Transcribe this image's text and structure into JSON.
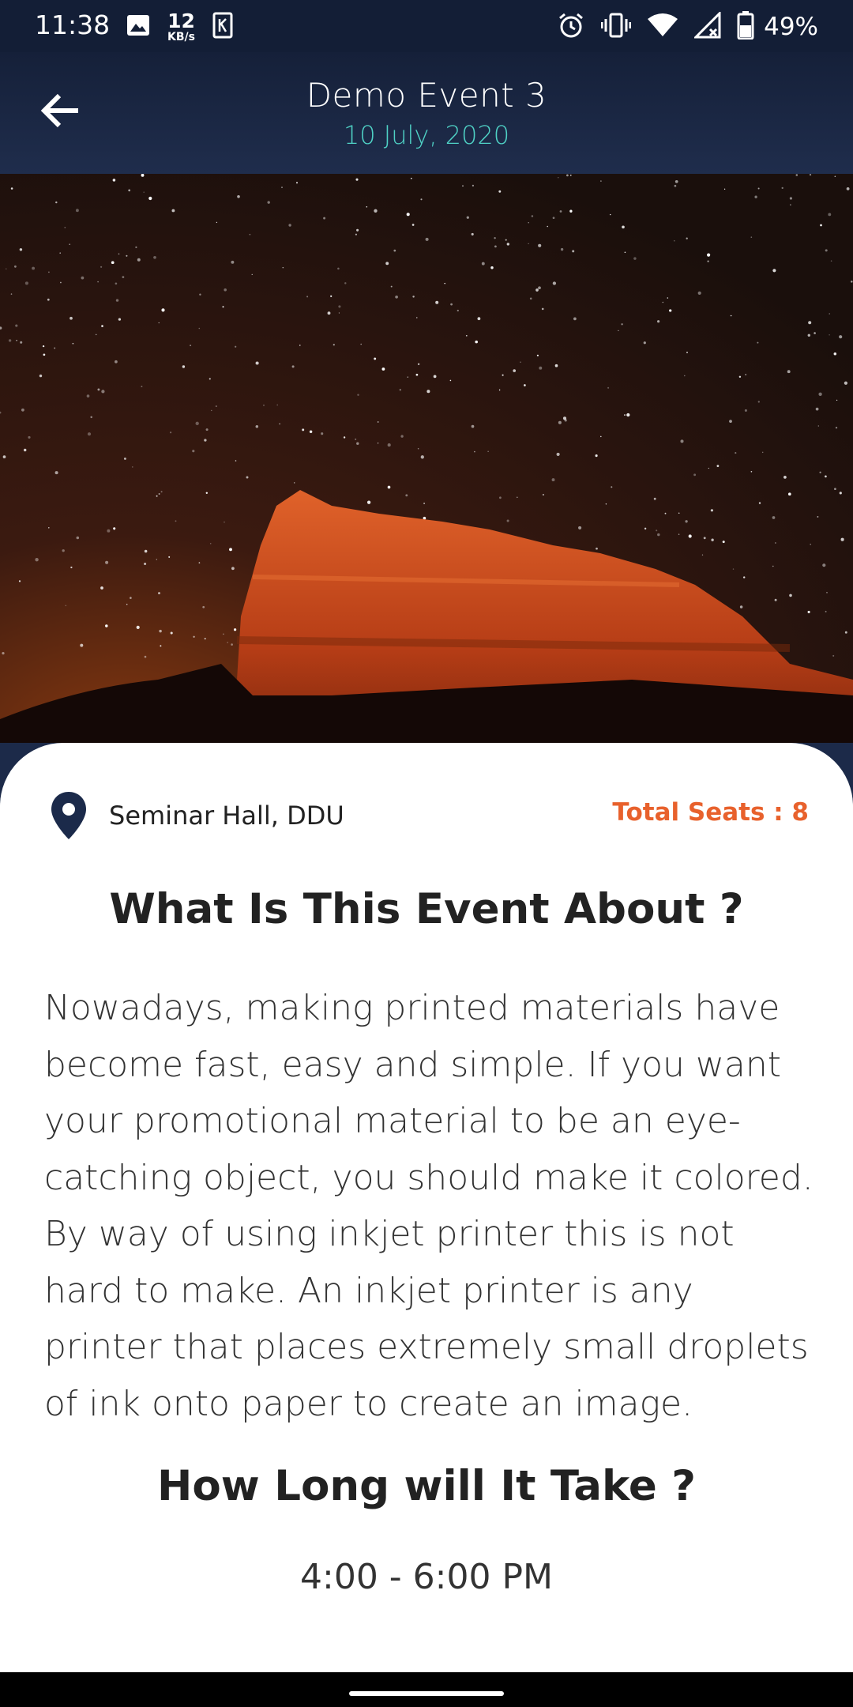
{
  "status_bar": {
    "time": "11:38",
    "net_speed_value": "12",
    "net_speed_unit": "KB/s",
    "battery": "49%",
    "icons_left": [
      "image-icon",
      "k-icon"
    ],
    "icons_right": [
      "alarm-icon",
      "vibrate-icon",
      "wifi-icon",
      "signal-icon",
      "battery-icon"
    ]
  },
  "header": {
    "title": "Demo Event 3",
    "date": "10 July, 2020",
    "back_icon": "arrow-left-icon"
  },
  "event": {
    "location": "Seminar Hall, DDU",
    "total_seats": "Total Seats : 8",
    "about_heading": "What Is This Event About ?",
    "about_text": "Nowadays, making printed materials have become fast, easy and simple. If you want your promotional material to be an eye-catching object, you should make it colored. By way of using inkjet printer this is not hard to make. An inkjet printer is any printer that places extremely small droplets of ink onto paper to create an image.",
    "duration_heading": "How Long will It Take ?",
    "duration": "4:00 - 6:00 PM"
  },
  "colors": {
    "header_bg": "#152039",
    "date_accent": "#4fd1c5",
    "seats_accent": "#e8612c",
    "pin_color": "#1b2a4a"
  }
}
